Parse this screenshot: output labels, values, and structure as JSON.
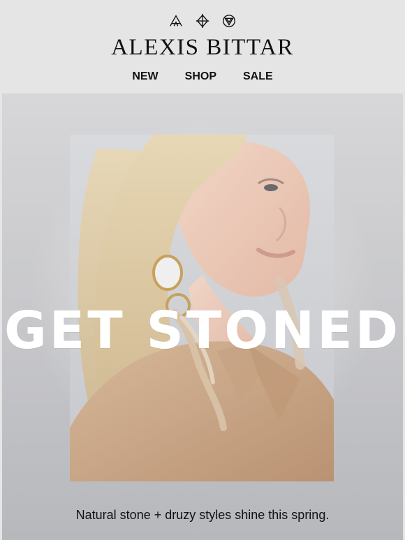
{
  "brand": {
    "name": "ALEXIS BITTAR",
    "icon_names": [
      "triangle-cross-icon",
      "diamond-cross-icon",
      "circle-triangle-icon"
    ]
  },
  "nav": {
    "items": [
      "NEW",
      "SHOP",
      "SALE"
    ]
  },
  "hero": {
    "headline": "GET STONED",
    "caption": "Natural stone + druzy styles shine this spring."
  },
  "colors": {
    "header_bg": "#e5e5e5",
    "text": "#111111",
    "hero_text": "#ffffff"
  }
}
